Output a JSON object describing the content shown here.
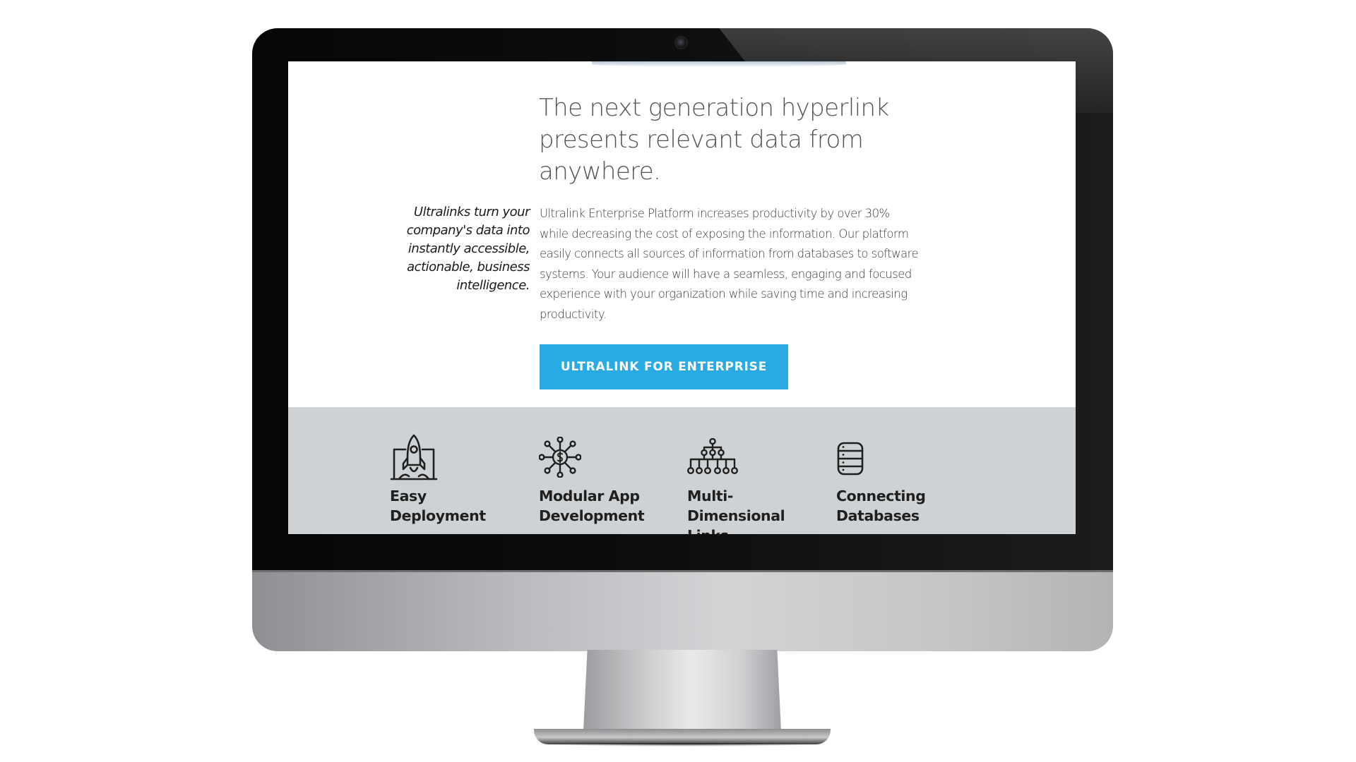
{
  "hero": {
    "headline": "The next generation hyperlink presents relevant data from anywhere.",
    "tagline": "Ultralinks turn your company's data into instantly accessible, actionable, business intelligence.",
    "body": "Ultralink Enterprise Platform increases productivity by over 30% while decreasing the cost of exposing the information. Our platform easily connects all sources of information from databases to software systems. Your audience will have a seamless, engaging and focused experience with your organization while saving time and increasing productivity.",
    "cta_label": "ULTRALINK FOR ENTERPRISE"
  },
  "colors": {
    "accent": "#29aae2",
    "feature_band": "#cfd2d4",
    "headline_text": "#555555"
  },
  "features": [
    {
      "label": "Easy Deployment",
      "icon": "rocket-launch-icon"
    },
    {
      "label": "Modular App Development",
      "icon": "dollar-network-icon"
    },
    {
      "label": "Multi-Dimensional Links",
      "icon": "hierarchy-icon"
    },
    {
      "label": "Connecting Databases",
      "icon": "database-icon"
    }
  ]
}
